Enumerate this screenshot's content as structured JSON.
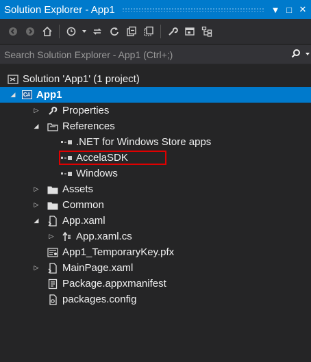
{
  "window": {
    "title": "Solution Explorer - App1",
    "menu_glyph": "▼",
    "maximize_glyph": "□",
    "close_glyph": "✕"
  },
  "search": {
    "placeholder": "Search Solution Explorer - App1 (Ctrl+;)"
  },
  "tree": {
    "solution": "Solution 'App1' (1 project)",
    "project": "App1",
    "project_badge": "C#",
    "properties": "Properties",
    "references": "References",
    "refs": [
      ".NET for Windows Store apps",
      "AccelaSDK",
      "Windows"
    ],
    "assets": "Assets",
    "common": "Common",
    "app_xaml": "App.xaml",
    "app_xaml_cs": "App.xaml.cs",
    "key": "App1_TemporaryKey.pfx",
    "mainpage": "MainPage.xaml",
    "manifest": "Package.appxmanifest",
    "packages": "packages.config"
  },
  "colors": {
    "accent": "#007acc",
    "highlight_border": "#e00000",
    "panel_bg": "#252526"
  }
}
